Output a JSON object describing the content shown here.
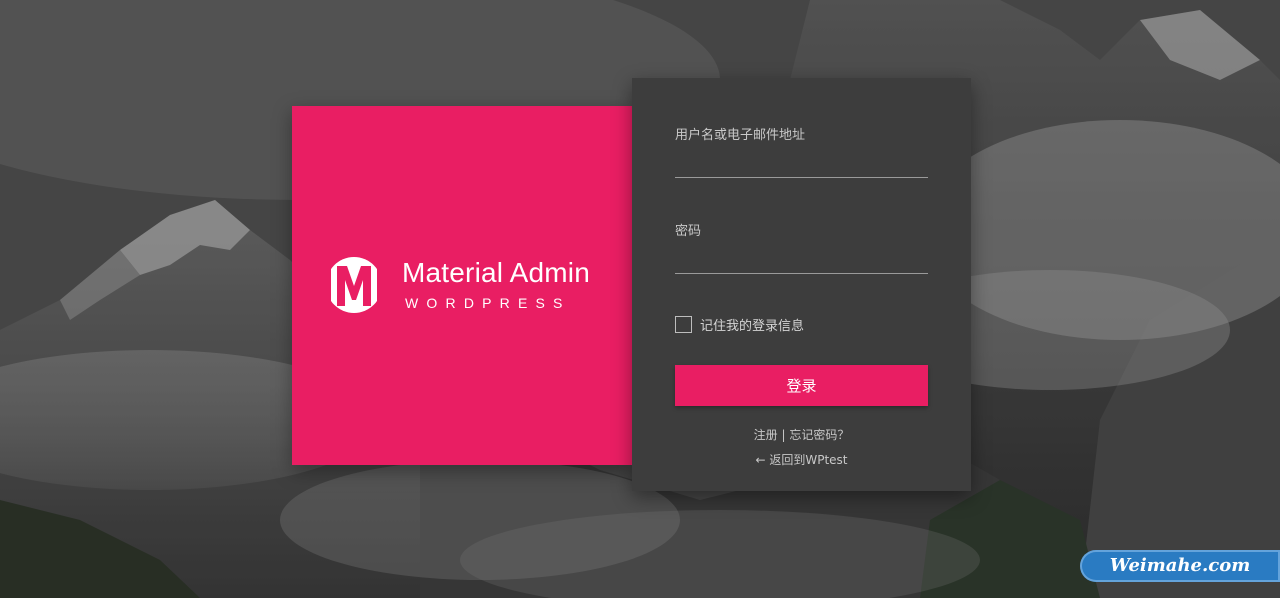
{
  "brand": {
    "logo_letter": "M",
    "title": "Material Admin",
    "subtitle": "WORDPRESS"
  },
  "form": {
    "username_label": "用户名或电子邮件地址",
    "username_value": "",
    "password_label": "密码",
    "password_value": "",
    "remember_label": "记住我的登录信息",
    "remember_checked": false,
    "submit_label": "登录",
    "register_link": "注册",
    "separator": " | ",
    "forgot_link": "忘记密码？",
    "back_link": "← 返回到WPtest"
  },
  "watermark": {
    "text": "Weimahe.com"
  },
  "colors": {
    "accent": "#e91e63",
    "form_bg": "#3d3d3d",
    "watermark_bg": "#2a7bc2"
  }
}
